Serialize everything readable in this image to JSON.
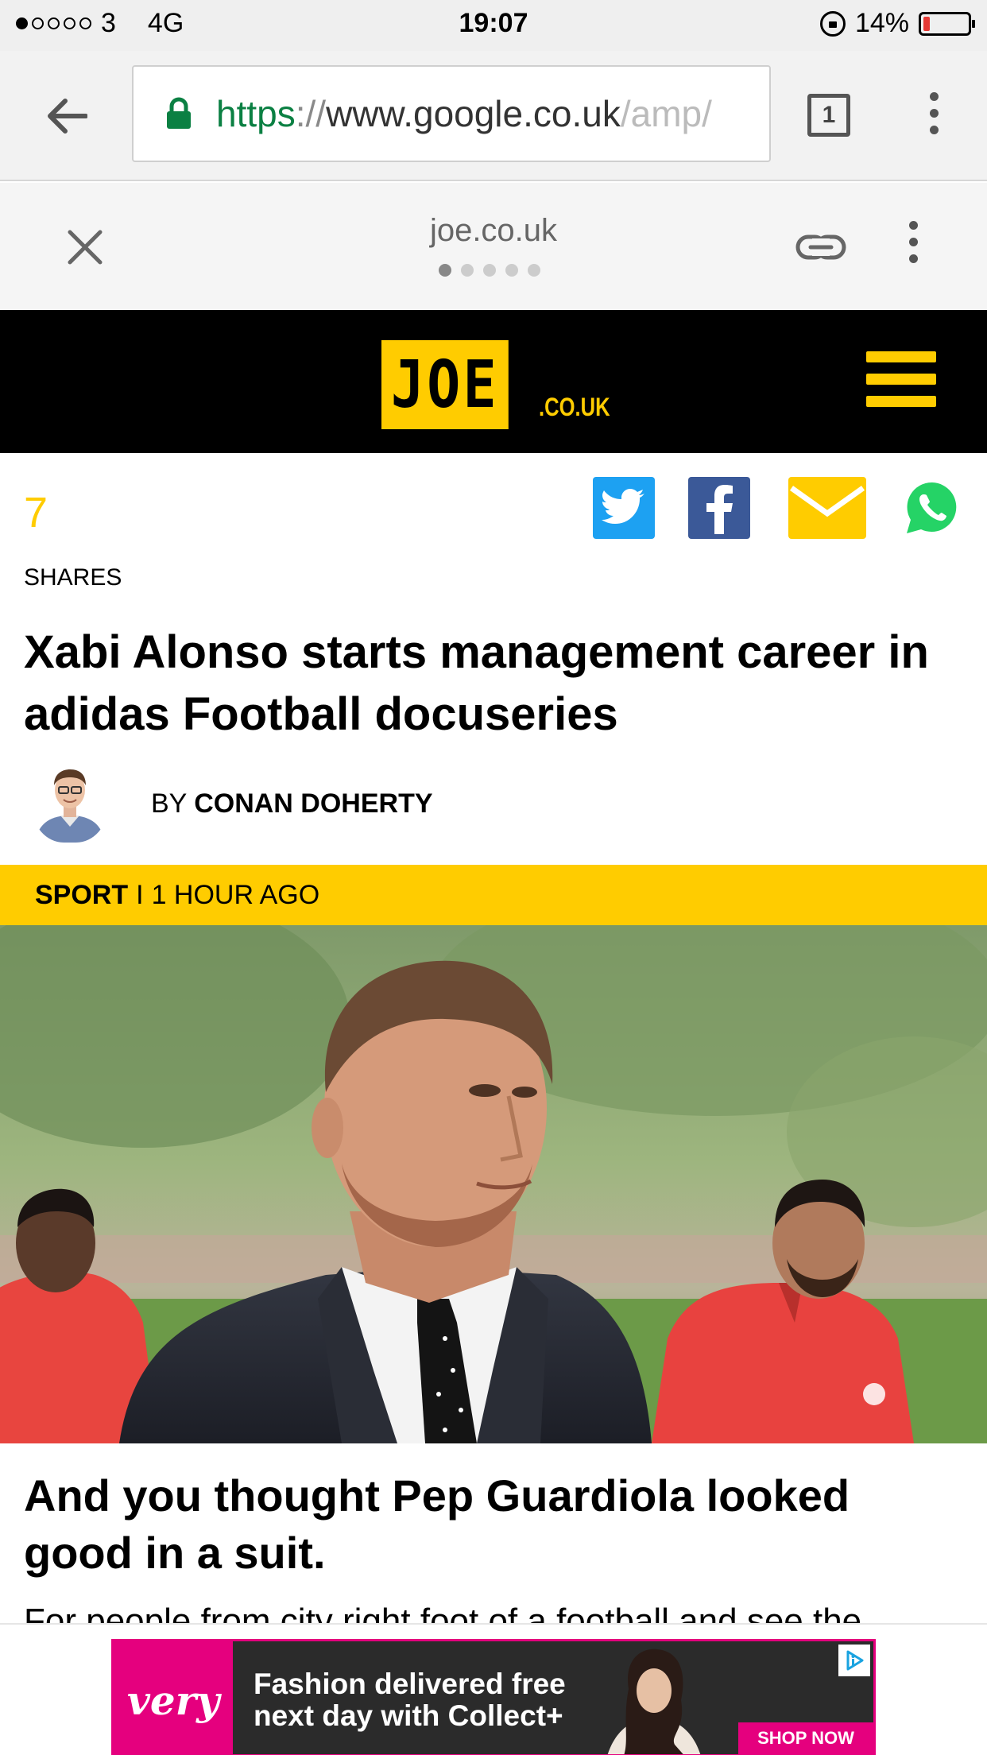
{
  "status_bar": {
    "signal_dots_on": 1,
    "carrier": "3",
    "network": "4G",
    "time": "19:07",
    "battery_percent": "14%",
    "battery_level": 0.14
  },
  "browser": {
    "url_scheme": "https",
    "url_separator": "://",
    "url_host": "www.google.co.uk",
    "url_path": "/amp/",
    "tab_count": "1",
    "icons": [
      "back-arrow-icon",
      "lock-icon",
      "tab-switcher-icon",
      "overflow-menu-icon"
    ]
  },
  "amp_viewer": {
    "domain": "joe.co.uk",
    "page_dots": 5,
    "active_dot": 0
  },
  "site_header": {
    "logo_text": "JOE",
    "logo_suffix": ".CO.UK",
    "accent_color": "#ffcc00"
  },
  "article": {
    "share_count": "7",
    "shares_label": "SHARES",
    "share_buttons": [
      "twitter-icon",
      "facebook-icon",
      "email-icon",
      "whatsapp-icon"
    ],
    "headline": "Xabi Alonso starts management career in adidas Football docuseries",
    "byline_prefix": "BY",
    "author": "CONAN DOHERTY",
    "category": "SPORT",
    "separator": "I",
    "posted": "1 HOUR AGO",
    "subheadline": "And you thought Pep Guardiola looked good in a suit.",
    "body_partial": "For people from city right foot of a football and see the"
  },
  "ad": {
    "brand": "very",
    "line1": "Fashion delivered free",
    "line2": "next day with Collect+",
    "cta": "SHOP NOW",
    "brand_color": "#e5007e"
  }
}
